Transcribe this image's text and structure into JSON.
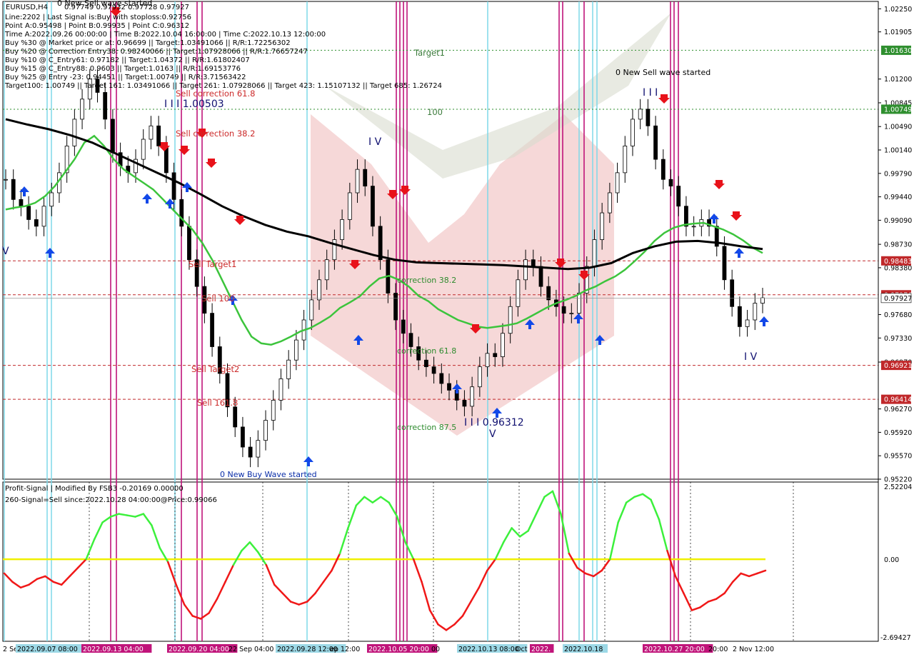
{
  "window": {
    "symbol": "EURUSD,H4",
    "ohlc": "0.97749 0.97932 0.97728 0.97927"
  },
  "info_lines": [
    "Line:2202 | Last Signal is:Buy with stoploss:0.92756",
    "Point A:0.95498 | Point B:0.99935 | Point C:0.96312",
    "Time A:2022.09.26 00:00:00 | Time B:2022.10.04 16:00:00 | Time C:2022.10.13 12:00:00",
    "Buy %20 @ Correction Entry38: 0.98240066 || Target:1.07928066 || R/R:1.76657247",
    "Buy %30 @ Market price or at: 0.96699 || Target:1.03491066 || R/R:1.72256302",
    "Buy %10 @ C_Entry61: 0.97182 || Target:1.04372 || R/R:1.61802407",
    "Buy %15 @ C_Entry88: 0.9603 || Target:1.0163 || R/R:1.69153776",
    "Buy %25 @ Entry -23: 0.94451 || Target:1.00749 || R/R:3.71563422",
    "Target100: 1.00749 || Target 161: 1.03491066 || Target 261: 1.07928066 || Target 423: 1.15107132 || Target 685: 1.26724"
  ],
  "annotations": {
    "top_wave": "0 New Sell wave started",
    "target1": "Target1",
    "level100": "100",
    "sell_correction_618": "Sell correction 61.8",
    "sell_correction_382": "Sell correction 38.2",
    "point_b_label": "I I I 1.00503",
    "new_sell_wave": "0 New Sell wave started",
    "sell_target1": "Sell Target1",
    "sell_100": "Sell 100",
    "sell_target2": "Sell Target2",
    "sell_1618": "Sell 161.8",
    "new_buy_wave": "0 New Buy Wave started",
    "correction_382": "correction 38.2",
    "correction_618": "correction 61.8",
    "correction_875": "correction 87.5",
    "point_c_label": "I I I 0.96312",
    "wave_iv_1": "I V",
    "wave_iii_2": "I I I",
    "wave_iv_2": "I V",
    "wave_v_1": "V",
    "wave_v_2": "V"
  },
  "price_axis": {
    "ticks": [
      "1.02250",
      "1.01905",
      "1.01200",
      "1.00845",
      "1.00490",
      "1.00140",
      "0.99790",
      "0.99440",
      "0.99090",
      "0.98730",
      "0.98380",
      "0.97680",
      "0.97330",
      "0.96970",
      "0.96270",
      "0.95920",
      "0.95570",
      "0.95220"
    ],
    "tagged_levels": [
      {
        "label": "1.01630",
        "value": 1.0163,
        "color": "#2f8f2f",
        "line": "dot-green"
      },
      {
        "label": "1.00749",
        "value": 1.00749,
        "color": "#2f8f2f",
        "line": "dot-green"
      },
      {
        "label": "0.98483",
        "value": 0.98483,
        "color": "#c0282a",
        "line": "dash-red"
      },
      {
        "label": "0.97976",
        "value": 0.97976,
        "color": "#c0282a",
        "line": "dash-red"
      },
      {
        "label": "0.96921",
        "value": 0.96921,
        "color": "#c0282a",
        "line": "dash-red"
      },
      {
        "label": "0.96414",
        "value": 0.96414,
        "color": "#c0282a",
        "line": "dash-red"
      }
    ],
    "current_price": "0.97927"
  },
  "time_axis": {
    "labels": [
      "2 Sep",
      "2022.09.07 08:00",
      "2022.09.13 04:00",
      "2022.09.20 04:00",
      "22 Sep 04:00",
      "2022.09.28 12:00",
      "ep 12:00",
      "2022.10.05 20:00",
      "00",
      "2022.10.13 08:00",
      "Oct 0",
      "2022.",
      "2022.10.18",
      "2022.10.27 20:00",
      "20:00",
      "2 Nov 12:00"
    ]
  },
  "indicator": {
    "title": "Profit-Signal | Modified By FSB3 -0.20169 0.00000",
    "signal_text": "260-Signal=Sell since:2022.10.28 04:00:00@Price:0.99066",
    "axis_top": "2.52204",
    "axis_zero": "0.00",
    "axis_bottom": "-2.69427"
  },
  "chart_data": [
    {
      "type": "candlestick",
      "title": "EURUSD,H4",
      "ylim": [
        0.9522,
        1.0236
      ],
      "series": [
        {
          "name": "EURUSD,H4",
          "x": "H4 bars 2022.09.02 - 2022.11.03",
          "close": [
            0.997,
            0.994,
            0.993,
            0.991,
            0.99,
            0.993,
            0.995,
            0.998,
            1.002,
            1.006,
            1.009,
            1.012,
            1.01,
            1.006,
            1.001,
            0.999,
            0.998,
            1.0,
            1.003,
            1.005,
            1.002,
            0.998,
            0.994,
            0.99,
            0.985,
            0.981,
            0.977,
            0.972,
            0.968,
            0.963,
            0.96,
            0.957,
            0.9555,
            0.958,
            0.961,
            0.964,
            0.9672,
            0.97,
            0.973,
            0.976,
            0.979,
            0.982,
            0.985,
            0.988,
            0.991,
            0.995,
            0.9985,
            0.996,
            0.99,
            0.985,
            0.98,
            0.976,
            0.974,
            0.972,
            0.97,
            0.969,
            0.968,
            0.9665,
            0.9655,
            0.964,
            0.9631,
            0.966,
            0.969,
            0.971,
            0.9705,
            0.974,
            0.978,
            0.982,
            0.985,
            0.984,
            0.981,
            0.979,
            0.978,
            0.977,
            0.977,
            0.98,
            0.984,
            0.988,
            0.992,
            0.995,
            0.998,
            1.002,
            1.006,
            1.0075,
            1.005,
            1.0,
            0.997,
            0.996,
            0.993,
            0.99,
            0.99,
            0.991,
            0.99,
            0.987,
            0.982,
            0.978,
            0.975,
            0.976,
            0.9785,
            0.9793
          ]
        },
        {
          "name": "moving average 1",
          "values": [
            0.9925,
            0.9928,
            0.993,
            0.9935,
            0.9945,
            0.996,
            0.998,
            1.0,
            1.0025,
            1.0035,
            1.002,
            1.0,
            0.9985,
            0.9975,
            0.9965,
            0.9955,
            0.994,
            0.9925,
            0.991,
            0.9895,
            0.9875,
            0.985,
            0.982,
            0.979,
            0.976,
            0.9735,
            0.9725,
            0.9723,
            0.9728,
            0.9735,
            0.9743,
            0.9748,
            0.9756,
            0.9765,
            0.9778,
            0.9786,
            0.9795,
            0.981,
            0.9822,
            0.9826,
            0.982,
            0.981,
            0.9796,
            0.9788,
            0.9776,
            0.9768,
            0.976,
            0.9755,
            0.975,
            0.9748,
            0.975,
            0.9752,
            0.9755,
            0.9762,
            0.977,
            0.9778,
            0.9785,
            0.979,
            0.9796,
            0.9804,
            0.981,
            0.9818,
            0.9825,
            0.9835,
            0.9848,
            0.9862,
            0.9878,
            0.989,
            0.9898,
            0.9902,
            0.9904,
            0.9905,
            0.99,
            0.9895,
            0.9888,
            0.9879,
            0.9868,
            0.986
          ]
        },
        {
          "name": "moving average 2",
          "values": [
            1.006,
            1.0052,
            1.0045,
            1.0036,
            1.0025,
            1.001,
            0.9995,
            0.998,
            0.9965,
            0.9948,
            0.993,
            0.9915,
            0.9902,
            0.9892,
            0.9885,
            0.9875,
            0.9866,
            0.9857,
            0.985,
            0.9846,
            0.9845,
            0.9844,
            0.9843,
            0.9842,
            0.984,
            0.9838,
            0.9836,
            0.9838,
            0.9845,
            0.986,
            0.987,
            0.9877,
            0.9878,
            0.9875,
            0.987,
            0.9866
          ]
        }
      ]
    },
    {
      "type": "line",
      "title": "Profit-Signal | Modified By FSB3 -0.20169 0.00000",
      "ylim": [
        -2.69427,
        2.52204
      ],
      "series": [
        {
          "name": "Profit-Signal",
          "values": [
            -0.5,
            -0.8,
            -1.0,
            -0.9,
            -0.7,
            -0.6,
            -0.8,
            -0.9,
            -0.6,
            -0.3,
            0.0,
            0.7,
            1.3,
            1.5,
            1.6,
            1.55,
            1.5,
            1.6,
            1.2,
            0.4,
            -0.1,
            -0.9,
            -1.6,
            -2.0,
            -2.1,
            -1.9,
            -1.4,
            -0.8,
            -0.2,
            0.3,
            0.6,
            0.25,
            -0.2,
            -0.9,
            -1.2,
            -1.5,
            -1.6,
            -1.5,
            -1.2,
            -0.8,
            -0.4,
            0.2,
            1.1,
            1.9,
            2.2,
            2.0,
            2.2,
            2.0,
            1.5,
            0.6,
            0.0,
            -0.8,
            -1.8,
            -2.3,
            -2.5,
            -2.3,
            -2.0,
            -1.5,
            -1.0,
            -0.4,
            0.0,
            0.6,
            1.1,
            0.8,
            1.0,
            1.6,
            2.2,
            2.4,
            1.6,
            0.2,
            -0.3,
            -0.5,
            -0.6,
            -0.4,
            0.0,
            1.3,
            2.0,
            2.2,
            2.3,
            2.1,
            1.4,
            0.3,
            -0.6,
            -1.2,
            -1.8,
            -1.7,
            -1.5,
            -1.4,
            -1.2,
            -0.8,
            -0.5,
            -0.6,
            -0.5,
            -0.4
          ]
        }
      ]
    }
  ]
}
